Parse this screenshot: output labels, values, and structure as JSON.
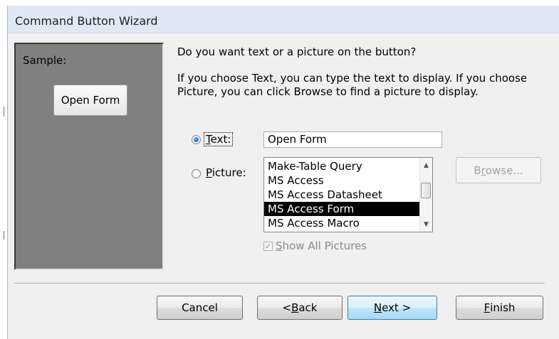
{
  "window": {
    "title": "Command Button Wizard"
  },
  "sample": {
    "label": "Sample:",
    "button_text": "Open Form"
  },
  "prompt": {
    "question": "Do you want text or a picture on the button?",
    "instructions": "If you choose Text, you can type the text to display.  If you choose Picture, you can click Browse to find a picture to display."
  },
  "options": {
    "text_radio": {
      "accel": "T",
      "rest": "ext:",
      "checked": true,
      "value": "Open Form"
    },
    "picture_radio": {
      "accel": "P",
      "rest": "icture:",
      "checked": false
    }
  },
  "picture_list": {
    "items": [
      "Make-Table Query",
      "MS Access",
      "MS Access Datasheet",
      "MS Access Form",
      "MS Access Macro"
    ],
    "selected": "MS Access Form"
  },
  "browse": {
    "pre": "B",
    "accel": "r",
    "post": "owse...",
    "enabled": false
  },
  "show_all": {
    "accel": "S",
    "rest": "how All Pictures",
    "checked": true,
    "enabled": false
  },
  "buttons": {
    "cancel": "Cancel",
    "back": {
      "pre": "< ",
      "accel": "B",
      "post": "ack"
    },
    "next": {
      "accel": "N",
      "post": "ext >"
    },
    "finish": {
      "accel": "F",
      "post": "inish"
    }
  }
}
